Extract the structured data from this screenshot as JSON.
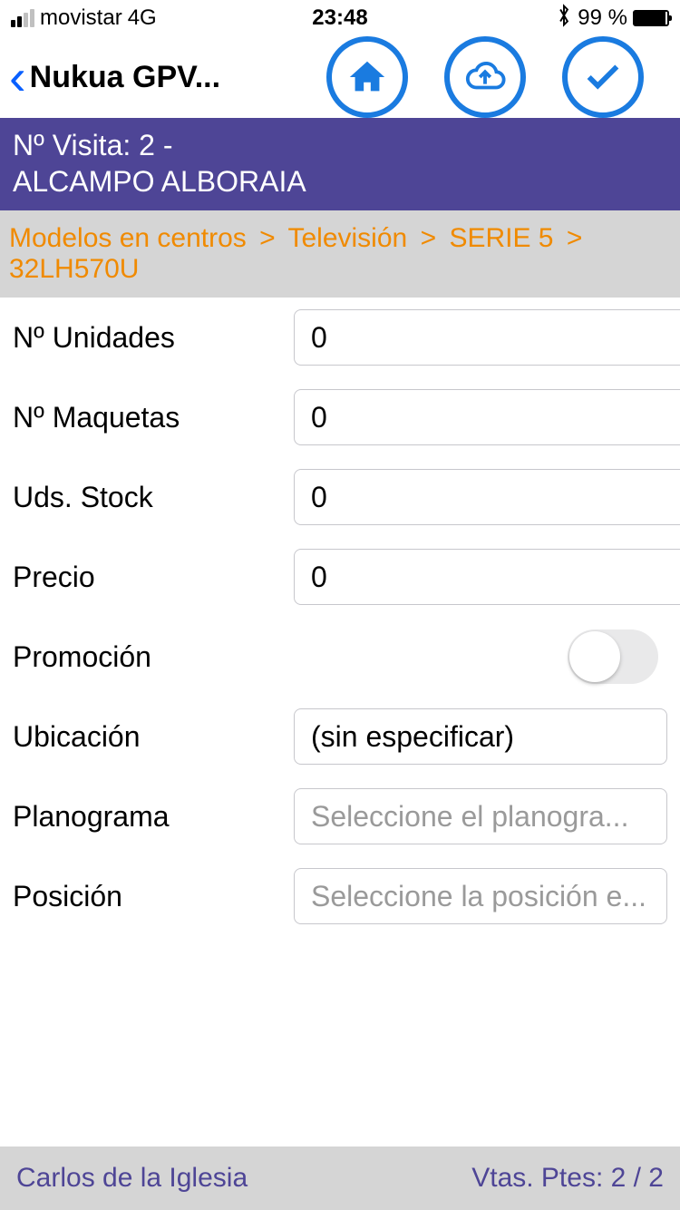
{
  "status": {
    "carrier": "movistar",
    "network": "4G",
    "time": "23:48",
    "bluetooth": "✱",
    "battery_pct": "99 %"
  },
  "nav": {
    "back_title": "Nukua GPV..."
  },
  "visit": {
    "line1": "Nº Visita: 2 -",
    "line2": "ALCAMPO ALBORAIA"
  },
  "breadcrumb": {
    "a": "Modelos en centros",
    "b": "Televisión",
    "c": "SERIE 5",
    "d": "32LH570U",
    "sep": ">"
  },
  "form": {
    "unidades": {
      "label": "Nº Unidades",
      "value": "0"
    },
    "maquetas": {
      "label": "Nº Maquetas",
      "value": "0"
    },
    "stock": {
      "label": "Uds. Stock",
      "value": "0"
    },
    "precio": {
      "label": "Precio",
      "value": "0"
    },
    "promocion": {
      "label": "Promoción"
    },
    "ubicacion": {
      "label": "Ubicación",
      "value": "(sin especificar)"
    },
    "planograma": {
      "label": "Planograma",
      "placeholder": "Seleccione el planogra..."
    },
    "posicion": {
      "label": "Posición",
      "placeholder": "Seleccione la posición e..."
    }
  },
  "footer": {
    "user": "Carlos de la Iglesia",
    "vtas": "Vtas. Ptes: 2 / 2"
  }
}
